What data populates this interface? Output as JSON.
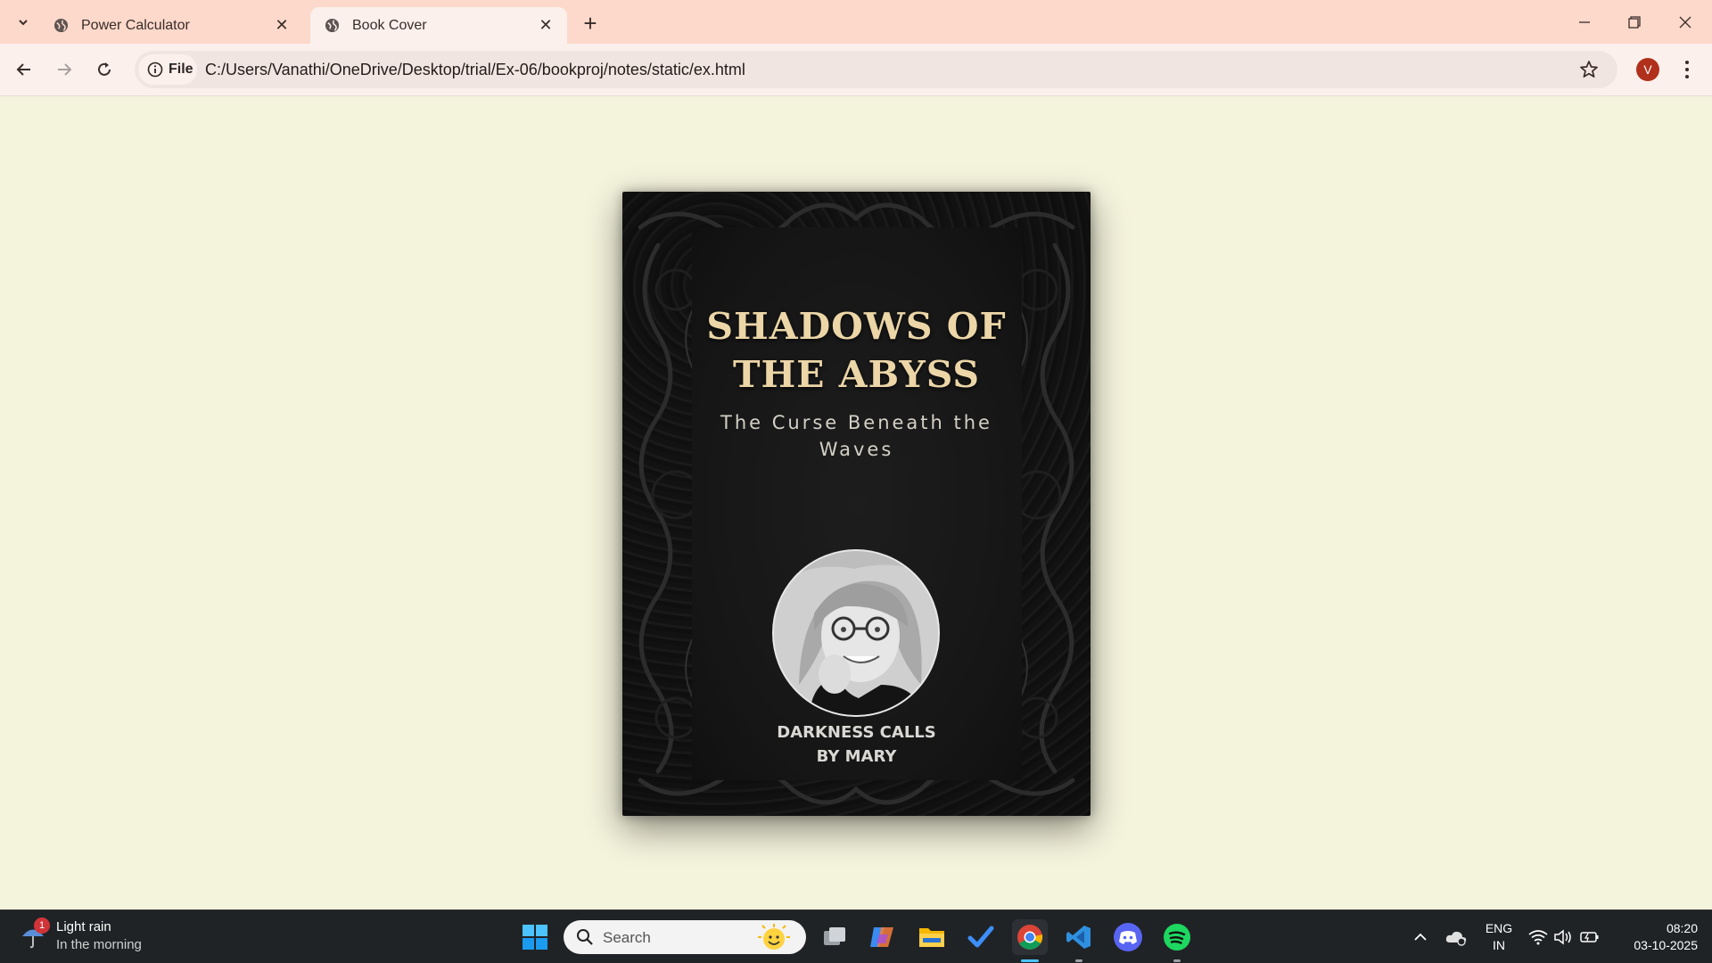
{
  "browser": {
    "tabs": [
      {
        "label": "Power Calculator",
        "active": false
      },
      {
        "label": "Book Cover",
        "active": true
      }
    ],
    "new_tab_icon": "plus-icon",
    "omnibox": {
      "chip_label": "File",
      "url": "C:/Users/Vanathi/OneDrive/Desktop/trial/Ex-06/bookproj/notes/static/ex.html"
    },
    "profile_initial": "V"
  },
  "book": {
    "title_line1": "SHADOWS OF",
    "title_line2": "THE ABYSS",
    "subtitle": "The Curse Beneath the Waves",
    "author_line1": "DARKNESS CALLS",
    "author_line2": "BY MARY",
    "title_color": "#ecd6a7"
  },
  "taskbar": {
    "weather": {
      "title": "Light rain",
      "detail": "In the morning",
      "badge": "1"
    },
    "search_label": "Search",
    "tray": {
      "lang1": "ENG",
      "lang2": "IN",
      "time": "08:20",
      "date": "03-10-2025"
    }
  }
}
